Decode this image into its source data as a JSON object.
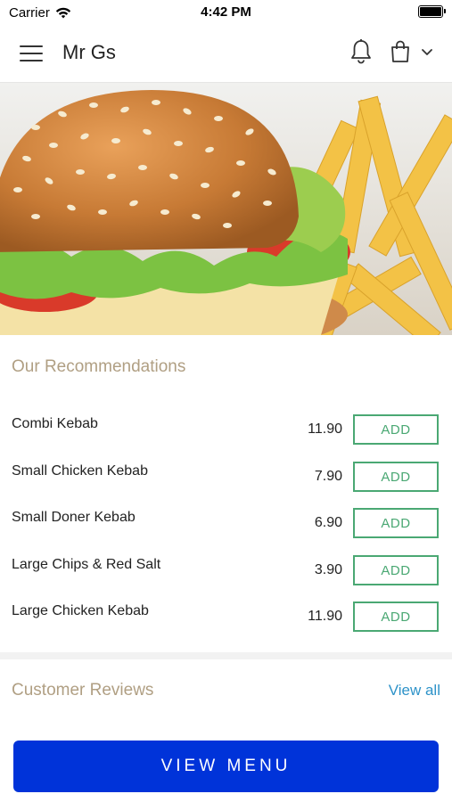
{
  "status_bar": {
    "carrier": "Carrier",
    "time": "4:42 PM"
  },
  "nav": {
    "title": "Mr Gs",
    "icons": [
      "menu-icon",
      "bell-icon",
      "shopping-bag-icon",
      "chevron-down-icon"
    ]
  },
  "hero": {
    "description_icon": "burger-and-fries-image"
  },
  "recommendations": {
    "title": "Our Recommendations",
    "items": [
      {
        "name": "Combi Kebab",
        "price": "11.90",
        "action": "ADD"
      },
      {
        "name": "Small Chicken Kebab",
        "price": "7.90",
        "action": "ADD"
      },
      {
        "name": "Small Doner Kebab",
        "price": "6.90",
        "action": "ADD"
      },
      {
        "name": "Large Chips & Red Salt",
        "price": "3.90",
        "action": "ADD"
      },
      {
        "name": "Large Chicken Kebab",
        "price": "11.90",
        "action": "ADD"
      }
    ]
  },
  "reviews": {
    "title": "Customer Reviews",
    "view_all": "View all"
  },
  "cta": {
    "label": "VIEW MENU"
  },
  "colors": {
    "accent_title": "#b09f83",
    "add_green": "#4aa873",
    "link_blue": "#2e93c9",
    "cta_blue": "#0033d9"
  }
}
